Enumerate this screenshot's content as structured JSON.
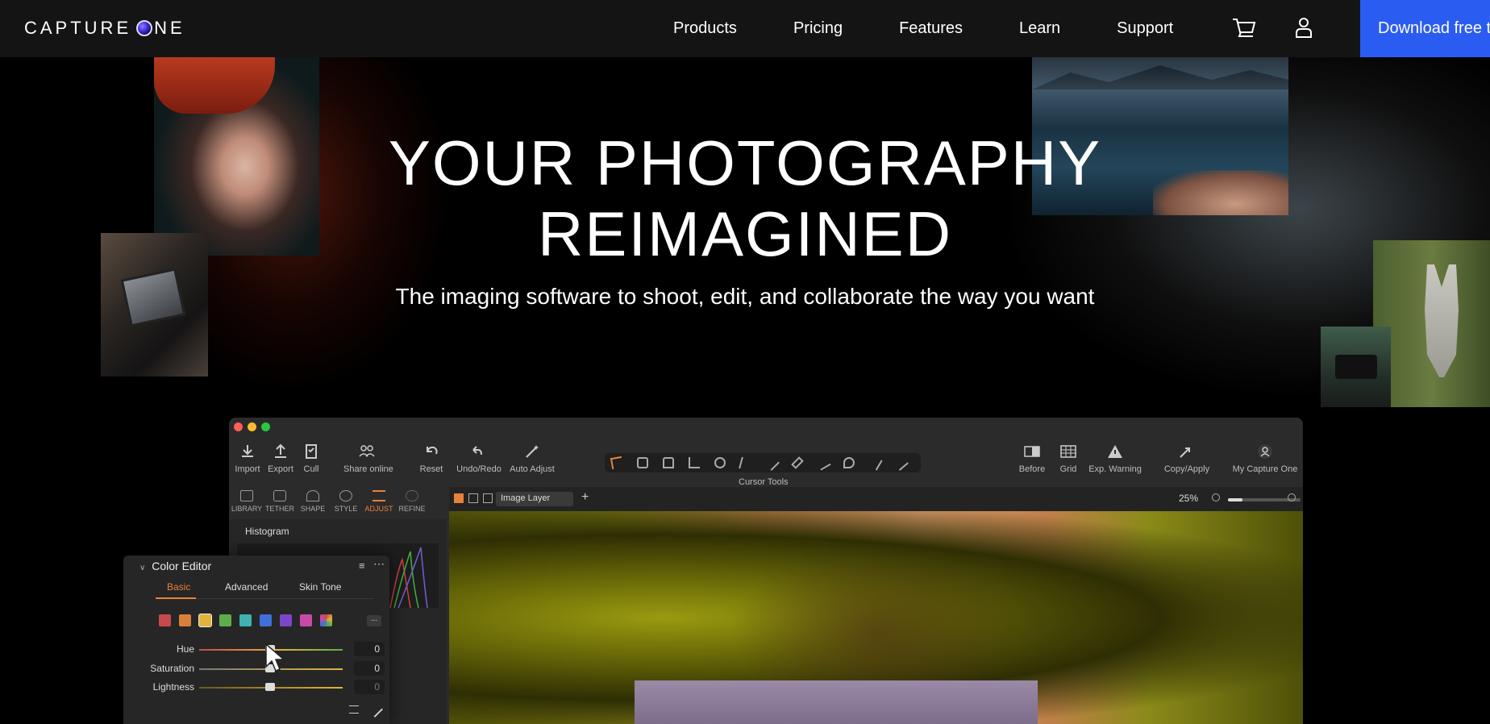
{
  "nav": {
    "logo_text": "CAPTURE ONE",
    "links": [
      "Products",
      "Pricing",
      "Features",
      "Learn",
      "Support"
    ],
    "cart_icon": "cart-icon",
    "account_icon": "user-icon",
    "download_label": "Download free t"
  },
  "hero": {
    "headline_line1": "YOUR PHOTOGRAPHY",
    "headline_line2": "REIMAGINED",
    "subhead": "The imaging software to shoot, edit, and collaborate the way you want"
  },
  "app": {
    "toolbar": {
      "import": "Import",
      "export": "Export",
      "cull": "Cull",
      "share_online": "Share online",
      "reset": "Reset",
      "undo_redo": "Undo/Redo",
      "auto_adjust": "Auto Adjust",
      "cursor_tools": "Cursor Tools",
      "before": "Before",
      "grid": "Grid",
      "exp_warning": "Exp. Warning",
      "copy_apply": "Copy/Apply",
      "my_capture_one": "My Capture One"
    },
    "tool_tabs": [
      "LIBRARY",
      "TETHER",
      "SHAPE",
      "STYLE",
      "ADJUST",
      "REFINE"
    ],
    "active_tool_tab": "ADJUST",
    "viewer": {
      "layer_select": "Image Layer",
      "zoom": "25%"
    },
    "histogram_title": "Histogram"
  },
  "color_editor": {
    "title": "Color Editor",
    "tabs": [
      "Basic",
      "Advanced",
      "Skin Tone"
    ],
    "active_tab": "Basic",
    "swatch_colors": [
      "#c8494b",
      "#d8803a",
      "#e2b23c",
      "#5dad4a",
      "#3fb3b0",
      "#3f6fd8",
      "#7c46c8",
      "#c84aa8"
    ],
    "more_label": "...",
    "sliders": [
      {
        "label": "Hue",
        "value": "0"
      },
      {
        "label": "Saturation",
        "value": "0"
      },
      {
        "label": "Lightness",
        "value": "0"
      }
    ]
  },
  "colors": {
    "accent_blue": "#2b5cf2",
    "accent_orange": "#e6823a",
    "nav_bg": "#141414"
  }
}
